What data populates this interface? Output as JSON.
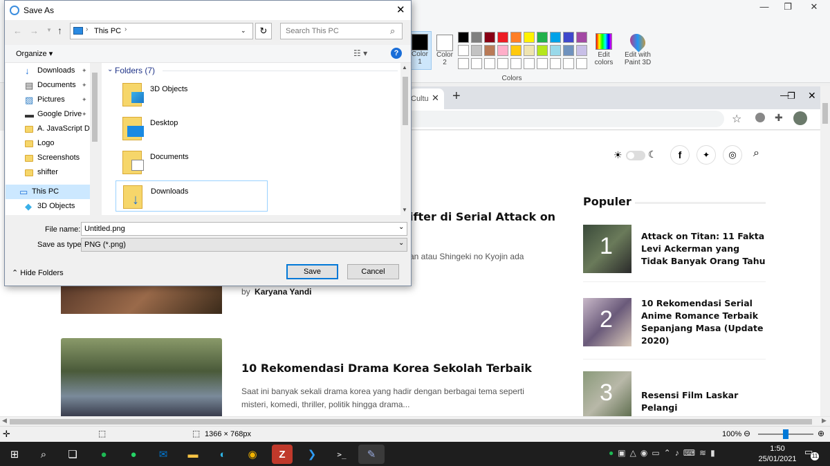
{
  "paint": {
    "color1_label": "Color 1",
    "color1_line1": "Color",
    "color1_line2": "1",
    "color2_line1": "Color",
    "color2_line2": "2",
    "edit_colors_line1": "Edit",
    "edit_colors_line2": "colors",
    "edit3d_line1": "Edit with",
    "edit3d_line2": "Paint 3D",
    "colors_group": "Colors",
    "palette_row1": [
      "#000000",
      "#7f7f7f",
      "#880015",
      "#ed1c24",
      "#ff7f27",
      "#fff200",
      "#22b14c",
      "#00a2e8",
      "#3f48cc",
      "#a349a4"
    ],
    "palette_row2": [
      "#ffffff",
      "#c3c3c3",
      "#b97a57",
      "#ffaec9",
      "#ffc90e",
      "#efe4b0",
      "#b5e61d",
      "#99d9ea",
      "#7092be",
      "#c8bfe7"
    ]
  },
  "browser": {
    "tab_title": "Cultu",
    "new_tab": "+"
  },
  "page": {
    "header_icons": [
      "sun-icon",
      "moon-icon",
      "facebook-icon",
      "twitter-icon",
      "instagram-icon",
      "search-icon"
    ],
    "article1_title_fragment": "ifter di Serial Attack on",
    "article1_excerpt_fragment": "an atau Shingeki no Kyojin ada",
    "article1_by": "by",
    "article1_author": "Karyana Yandi",
    "article2_title": "10 Rekomendasi Drama Korea Sekolah Terbaik",
    "article2_excerpt_line1": "Saat ini banyak sekali drama korea yang hadir dengan berbagai tema seperti",
    "article2_excerpt_line2": "misteri, komedi, thriller, politik hingga drama...",
    "populer_heading": "Populer",
    "populer": [
      {
        "rank": "1",
        "title": "Attack on Titan: 11 Fakta Levi Ackerman yang Tidak Banyak Orang Tahu"
      },
      {
        "rank": "2",
        "title": "10 Rekomendasi Serial Anime Romance Terbaik Sepanjang Masa (Update 2020)"
      },
      {
        "rank": "3",
        "title": "Resensi Film Laskar Pelangi"
      }
    ]
  },
  "status": {
    "dimensions": "1366 × 768px",
    "zoom": "100%",
    "zoom_level": 0.5
  },
  "taskbar": {
    "time": "1:50",
    "date": "25/01/2021",
    "notif_count": "11"
  },
  "dialog": {
    "title": "Save As",
    "path_root": "This PC",
    "search_placeholder": "Search This PC",
    "organize": "Organize",
    "sidebar": [
      {
        "label": "Downloads",
        "icon": "download-icon",
        "pinned": true
      },
      {
        "label": "Documents",
        "icon": "document-icon",
        "pinned": true
      },
      {
        "label": "Pictures",
        "icon": "picture-icon",
        "pinned": true
      },
      {
        "label": "Google Drive",
        "icon": "drive-icon",
        "pinned": true
      },
      {
        "label": "A. JavaScript Das",
        "icon": "folder-icon",
        "pinned": false
      },
      {
        "label": "Logo",
        "icon": "folder-icon",
        "pinned": false
      },
      {
        "label": "Screenshots",
        "icon": "folder-icon",
        "pinned": false
      },
      {
        "label": "shifter",
        "icon": "folder-icon",
        "pinned": false
      },
      {
        "label": "This PC",
        "icon": "pc-icon",
        "pinned": false
      },
      {
        "label": "3D Objects",
        "icon": "cube-icon",
        "pinned": false
      }
    ],
    "folders_header": "Folders (7)",
    "folders": [
      "3D Objects",
      "Desktop",
      "Documents",
      "Downloads"
    ],
    "file_name_label": "File name:",
    "file_name_value": "Untitled.png",
    "save_type_label": "Save as type:",
    "save_type_value": "PNG (*.png)",
    "hide_folders": "Hide Folders",
    "save_btn": "Save",
    "cancel_btn": "Cancel"
  }
}
